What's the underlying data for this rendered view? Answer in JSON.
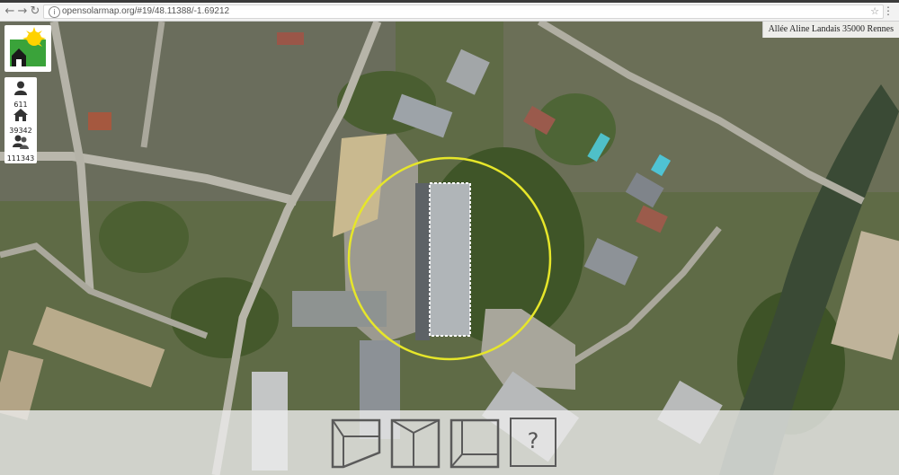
{
  "browser": {
    "url": "opensolarmap.org/#19/48.11388/-1.69212",
    "back_icon": "arrow-left-icon",
    "forward_icon": "arrow-right-icon",
    "reload_icon": "reload-icon",
    "star_icon": "star-icon",
    "menu_icon": "kebab-menu-icon"
  },
  "map": {
    "address": "Allée Aline Landais 35000 Rennes",
    "highlight_color": "#e6e62a",
    "selected_roof_outline": "#ffffff"
  },
  "stats": [
    {
      "icon": "person-icon",
      "value": "611"
    },
    {
      "icon": "house-icon",
      "value": "39342"
    },
    {
      "icon": "group-icon",
      "value": "111343"
    }
  ],
  "toolbar": {
    "tools": [
      {
        "name": "flat-roof-tool",
        "icon": "flat-roof-icon"
      },
      {
        "name": "gable-roof-tool",
        "icon": "gable-roof-icon"
      },
      {
        "name": "shed-roof-tool",
        "icon": "shed-roof-icon"
      }
    ],
    "help_label": "?"
  },
  "colors": {
    "toolbar_bg": "#ececec",
    "logo_green": "#3aa33a",
    "logo_sun": "#ffd200"
  }
}
